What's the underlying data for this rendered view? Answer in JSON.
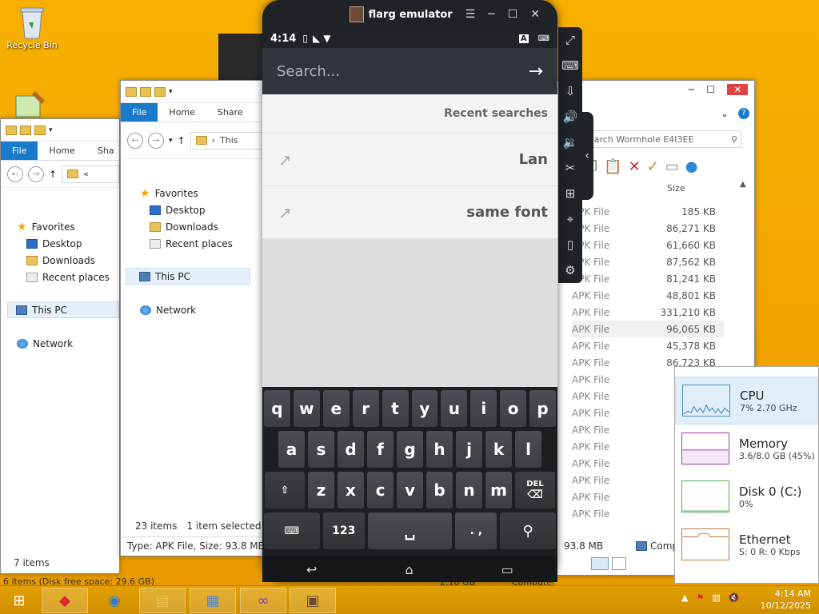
{
  "desktop": {
    "recycle_bin_label": "Recycle Bin"
  },
  "explorer_left": {
    "tabs": [
      "File",
      "Home",
      "Sha"
    ],
    "address": "«",
    "nav": {
      "favorites": "Favorites",
      "desktop": "Desktop",
      "downloads": "Downloads",
      "recent": "Recent places",
      "this_pc": "This PC",
      "network": "Network"
    },
    "status_items": "7 items",
    "status_bottom": "6 items (Disk free space: 29.6 GB)"
  },
  "explorer_mid": {
    "tabs": [
      "File",
      "Home",
      "Share"
    ],
    "address": "This",
    "nav": {
      "favorites": "Favorites",
      "desktop": "Desktop",
      "downloads": "Downloads",
      "recent": "Recent places",
      "this_pc": "This PC",
      "network": "Network"
    },
    "status_count": "23 items",
    "status_selected": "1 item selected  9",
    "details": "Type: APK File, Size: 93.8 MB, Da"
  },
  "explorer_right": {
    "search_placeholder": "earch Wormhole E4I3EE",
    "col_size": "Size",
    "rows": [
      {
        "type": "APK File",
        "size": "185 KB"
      },
      {
        "type": "APK File",
        "size": "86,271 KB"
      },
      {
        "type": "APK File",
        "size": "61,660 KB"
      },
      {
        "type": "APK File",
        "size": "87,562 KB"
      },
      {
        "type": "APK File",
        "size": "81,241 KB"
      },
      {
        "type": "APK File",
        "size": "48,801 KB"
      },
      {
        "type": "APK File",
        "size": "331,210 KB"
      },
      {
        "type": "APK File",
        "size": "96,065 KB"
      },
      {
        "type": "APK File",
        "size": "45,378 KB"
      },
      {
        "type": "APK File",
        "size": "86,723 KB"
      },
      {
        "type": "APK File",
        "size": ""
      },
      {
        "type": "APK File",
        "size": ""
      },
      {
        "type": "APK File",
        "size": ""
      },
      {
        "type": "APK File",
        "size": ""
      },
      {
        "type": "APK File",
        "size": ""
      },
      {
        "type": "APK File",
        "size": ""
      },
      {
        "type": "APK File",
        "size": ""
      },
      {
        "type": "APK File",
        "size": ""
      },
      {
        "type": "APK File",
        "size": ""
      }
    ],
    "status_size": "93.8 MB",
    "status_comp": "Comp",
    "bottom_size": "2.10 GB",
    "bottom_computer": "Computer"
  },
  "emulator": {
    "title": "flarg emulator",
    "time": "4:14",
    "search_placeholder": "Search...",
    "recent_header": "Recent searches",
    "recent": [
      "Lan",
      "same font"
    ],
    "keys_row1": [
      "q",
      "w",
      "e",
      "r",
      "t",
      "y",
      "u",
      "i",
      "o",
      "p"
    ],
    "keys_row2": [
      "a",
      "s",
      "d",
      "f",
      "g",
      "h",
      "j",
      "k",
      "l"
    ],
    "keys_row3": [
      "z",
      "x",
      "c",
      "v",
      "b",
      "n",
      "m"
    ],
    "del_label": "DEL",
    "num_label": "123",
    "punct_label": ". ,"
  },
  "taskmgr": {
    "cpu_name": "CPU",
    "cpu_sub": "7%  2.70 GHz",
    "mem_name": "Memory",
    "mem_sub": "3.6/8.0 GB (45%)",
    "disk_name": "Disk 0 (C:)",
    "disk_sub": "0%",
    "eth_name": "Ethernet",
    "eth_sub": "S: 0  R: 0 Kbps"
  },
  "clock": {
    "time": "4:14 AM",
    "date": "10/12/2025"
  },
  "colors": {
    "desktop": "#f5a800",
    "ribbon_file": "#1979ca",
    "emulator_body": "#1f2327",
    "search_bar": "#30363c",
    "cpu_graph": "#4a90c8",
    "mem_graph": "#9a3db0",
    "disk_graph": "#4caf50",
    "eth_graph": "#b87a3a"
  }
}
